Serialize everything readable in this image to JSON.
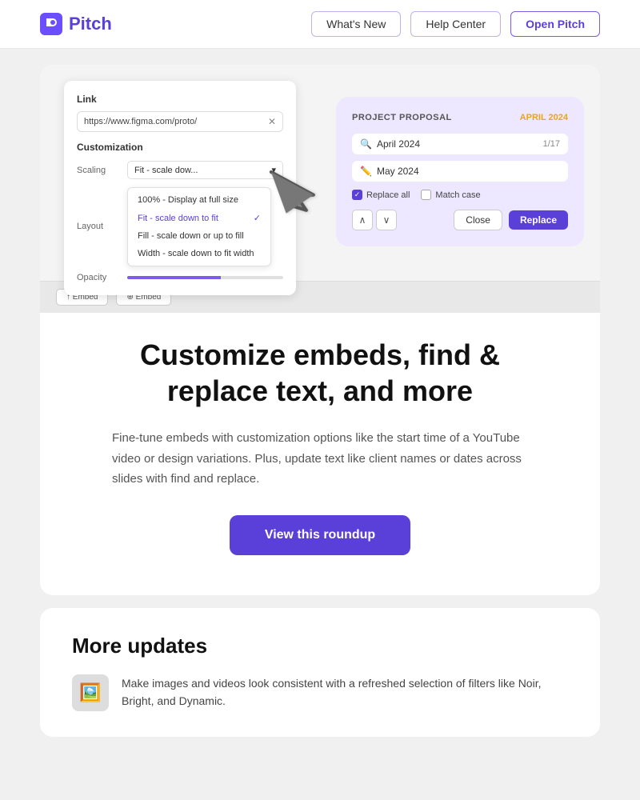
{
  "header": {
    "logo_text": "Pitch",
    "nav": {
      "whats_new": "What's New",
      "help_center": "Help Center",
      "open_pitch": "Open Pitch"
    }
  },
  "feature_section": {
    "embed_panel": {
      "label": "Link",
      "link_url": "https://www.figma.com/proto/",
      "customization_label": "Customization",
      "scaling_label": "Scaling",
      "scaling_value": "Fit - scale dow...",
      "layout_label": "Layout",
      "layout_value": "100% - Display at full size",
      "opacity_label": "Opacity",
      "dropdown_items": [
        "100% - Display at full size",
        "Fit - scale down to fit",
        "Fill - scale down or up to fill",
        "Width - scale down to fit width"
      ],
      "selected_item": "Fit - scale down to fit"
    },
    "find_replace_panel": {
      "project_title": "PROJECT PROPOSAL",
      "project_date": "APRIL 2024",
      "search_value": "April 2024",
      "search_count": "1/17",
      "replace_value": "May 2024",
      "replace_all_label": "Replace all",
      "match_case_label": "Match case",
      "close_label": "Close",
      "replace_label": "Replace"
    },
    "headline": "Customize embeds, find & replace text, and more",
    "description": "Fine-tune embeds with customization options like the start time of a YouTube video or design variations. Plus, update text like client names or dates across slides with find and replace.",
    "cta_label": "View this roundup"
  },
  "more_updates": {
    "title": "More updates",
    "items": [
      {
        "icon": "🖼️",
        "text": "Make images and videos look consistent with a refreshed selection of filters like Noir, Bright, and Dynamic."
      }
    ]
  }
}
